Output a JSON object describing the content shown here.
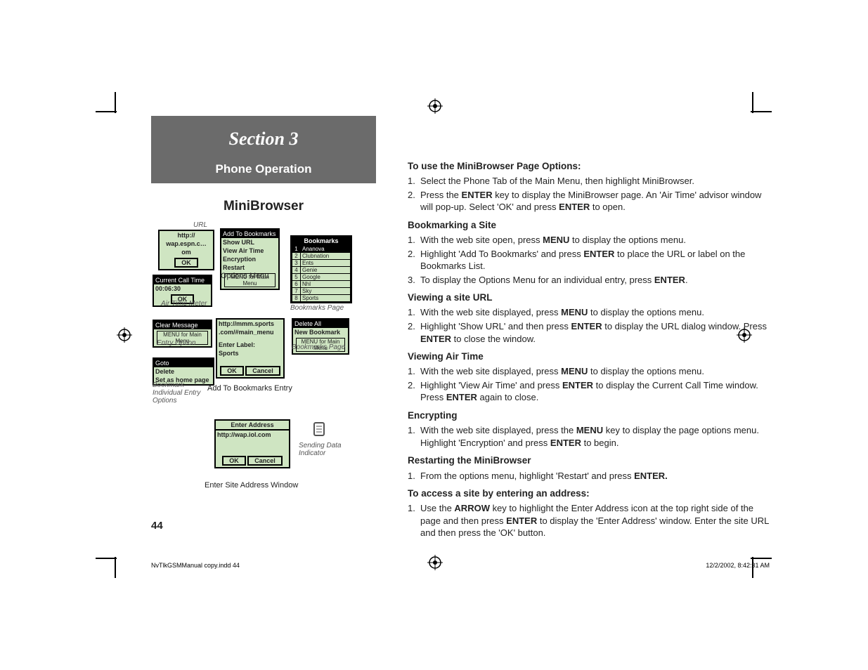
{
  "banner": {
    "title": "Section 3",
    "sub": "Phone Operation"
  },
  "mini_title": "MiniBrowser",
  "captions": {
    "url": "URL",
    "options_menu": "Options Menu",
    "air_time": "Air Time Meter",
    "bookmarks_page": "Bookmarks Page",
    "entry_option": "Entry Option",
    "bookmarks_page2": "Bookmarks Page",
    "bookmark_ind": "Bookmark Individual Entry Options",
    "add_to": "Add To Bookmarks Entry",
    "enter_site": "Enter Site Address Window",
    "sending_data": "Sending Data Indicator"
  },
  "figs": {
    "url_box": {
      "l1": "http://",
      "l2": "wap.espn.c…",
      "l3": "om",
      "ok": "OK"
    },
    "options_menu": {
      "i0": "Add To Bookmarks",
      "i1": "Show URL",
      "i2": "View Air Time",
      "i3": "Encryption",
      "i4": "Restart",
      "hint": "MENU for Main Menu"
    },
    "airtime": {
      "title": "Current Call Time",
      "time": "00:06:30",
      "ok": "OK"
    },
    "bookmarks": {
      "head": "Bookmarks",
      "rows": [
        {
          "n": "1",
          "v": "Ananova"
        },
        {
          "n": "2",
          "v": "Clubnation"
        },
        {
          "n": "3",
          "v": "Ents"
        },
        {
          "n": "4",
          "v": "Genie"
        },
        {
          "n": "5",
          "v": "Google"
        },
        {
          "n": "6",
          "v": "Nhl"
        },
        {
          "n": "7",
          "v": "Sky"
        },
        {
          "n": "8",
          "v": "Sports"
        }
      ]
    },
    "entry_option": {
      "i0": "Clear Message",
      "hint": "MENU for Main Menu"
    },
    "bookmarks_opts": {
      "i0": "Delete All",
      "i1": "New Bookmark",
      "hint": "MENU for Main Menu"
    },
    "ind_entry": {
      "i0": "Goto",
      "i1": "Delete",
      "i2": "Set as home page"
    },
    "add_entry": {
      "url1": "http://mmm.sports",
      "url2": ".com/#main_menu",
      "label_prompt": "Enter Label:",
      "label_val": "Sports",
      "ok": "OK",
      "cancel": "Cancel"
    },
    "enter_addr": {
      "title": "Enter Address",
      "url": "http://wap.iol.com",
      "ok": "OK",
      "cancel": "Cancel"
    }
  },
  "right": {
    "h1": "To use the MiniBrowser Page Options:",
    "s1_1": "1.",
    "t1_1": "Select the Phone Tab of the Main Menu, then highlight MiniBrowser.",
    "s1_2": "2.",
    "t1_2a": "Press the ",
    "t1_2b": "ENTER",
    "t1_2c": " key to display the MiniBrowser page. An 'Air Time' advisor window will pop-up.  Select 'OK' and press ",
    "t1_2d": "ENTER",
    "t1_2e": " to open.",
    "h2": "Bookmarking a Site",
    "s2_1": "1.",
    "t2_1a": "With the web site open, press  ",
    "t2_1b": "MENU",
    "t2_1c": " to display the options menu.",
    "s2_2": "2.",
    "t2_2a": "Highlight 'Add To Bookmarks' and press ",
    "t2_2b": "ENTER",
    "t2_2c": " to place the URL or label on the Bookmarks List.",
    "s2_3": "3.",
    "t2_3a": "To display the Options Menu for an individual entry, press ",
    "t2_3b": "ENTER",
    "t2_3c": ".",
    "h3": "Viewing a site URL",
    "s3_1": "1.",
    "t3_1a": "With the web site displayed, press ",
    "t3_1b": "MENU",
    "t3_1c": " to display the options menu.",
    "s3_2": "2.",
    "t3_2a": "Highlight 'Show URL' and then press ",
    "t3_2b": "ENTER",
    "t3_2c": " to display the URL dialog window. Press ",
    "t3_2d": "ENTER",
    "t3_2e": " to close the window.",
    "h4": "Viewing Air Time",
    "s4_1": "1.",
    "t4_1a": "With the web site displayed, press ",
    "t4_1b": "MENU",
    "t4_1c": " to display the options menu.",
    "s4_2": "2.",
    "t4_2a": "Highlight 'View Air Time' and press ",
    "t4_2b": "ENTER",
    "t4_2c": " to display the Current Call Time window. Press ",
    "t4_2d": "ENTER",
    "t4_2e": " again to close.",
    "h5": "Encrypting",
    "s5_1": "1.",
    "t5_1a": "With the web site displayed, press the ",
    "t5_1b": "MENU",
    "t5_1c": " key to display the page options menu. Highlight 'Encryption' and press ",
    "t5_1d": "ENTER",
    "t5_1e": " to begin.",
    "h6": "Restarting the MiniBrowser",
    "s6_1": "1.",
    "t6_1a": "From the options menu, highlight 'Restart' and press ",
    "t6_1b": "ENTER.",
    "t6_1c": "",
    "h7": "To access a site by entering an address:",
    "s7_1": "1.",
    "t7_1a": "Use the ",
    "t7_1b": "ARROW",
    "t7_1c": " key to highlight the Enter Address icon at the top right side of the page and then press ",
    "t7_1d": "ENTER",
    "t7_1e": " to display the 'Enter Address' window. Enter the site URL and then press the 'OK' button."
  },
  "pagenum": "44",
  "footer": {
    "left": "NvTlkGSMManual copy.indd   44",
    "right": "12/2/2002, 8:42:31 AM"
  }
}
